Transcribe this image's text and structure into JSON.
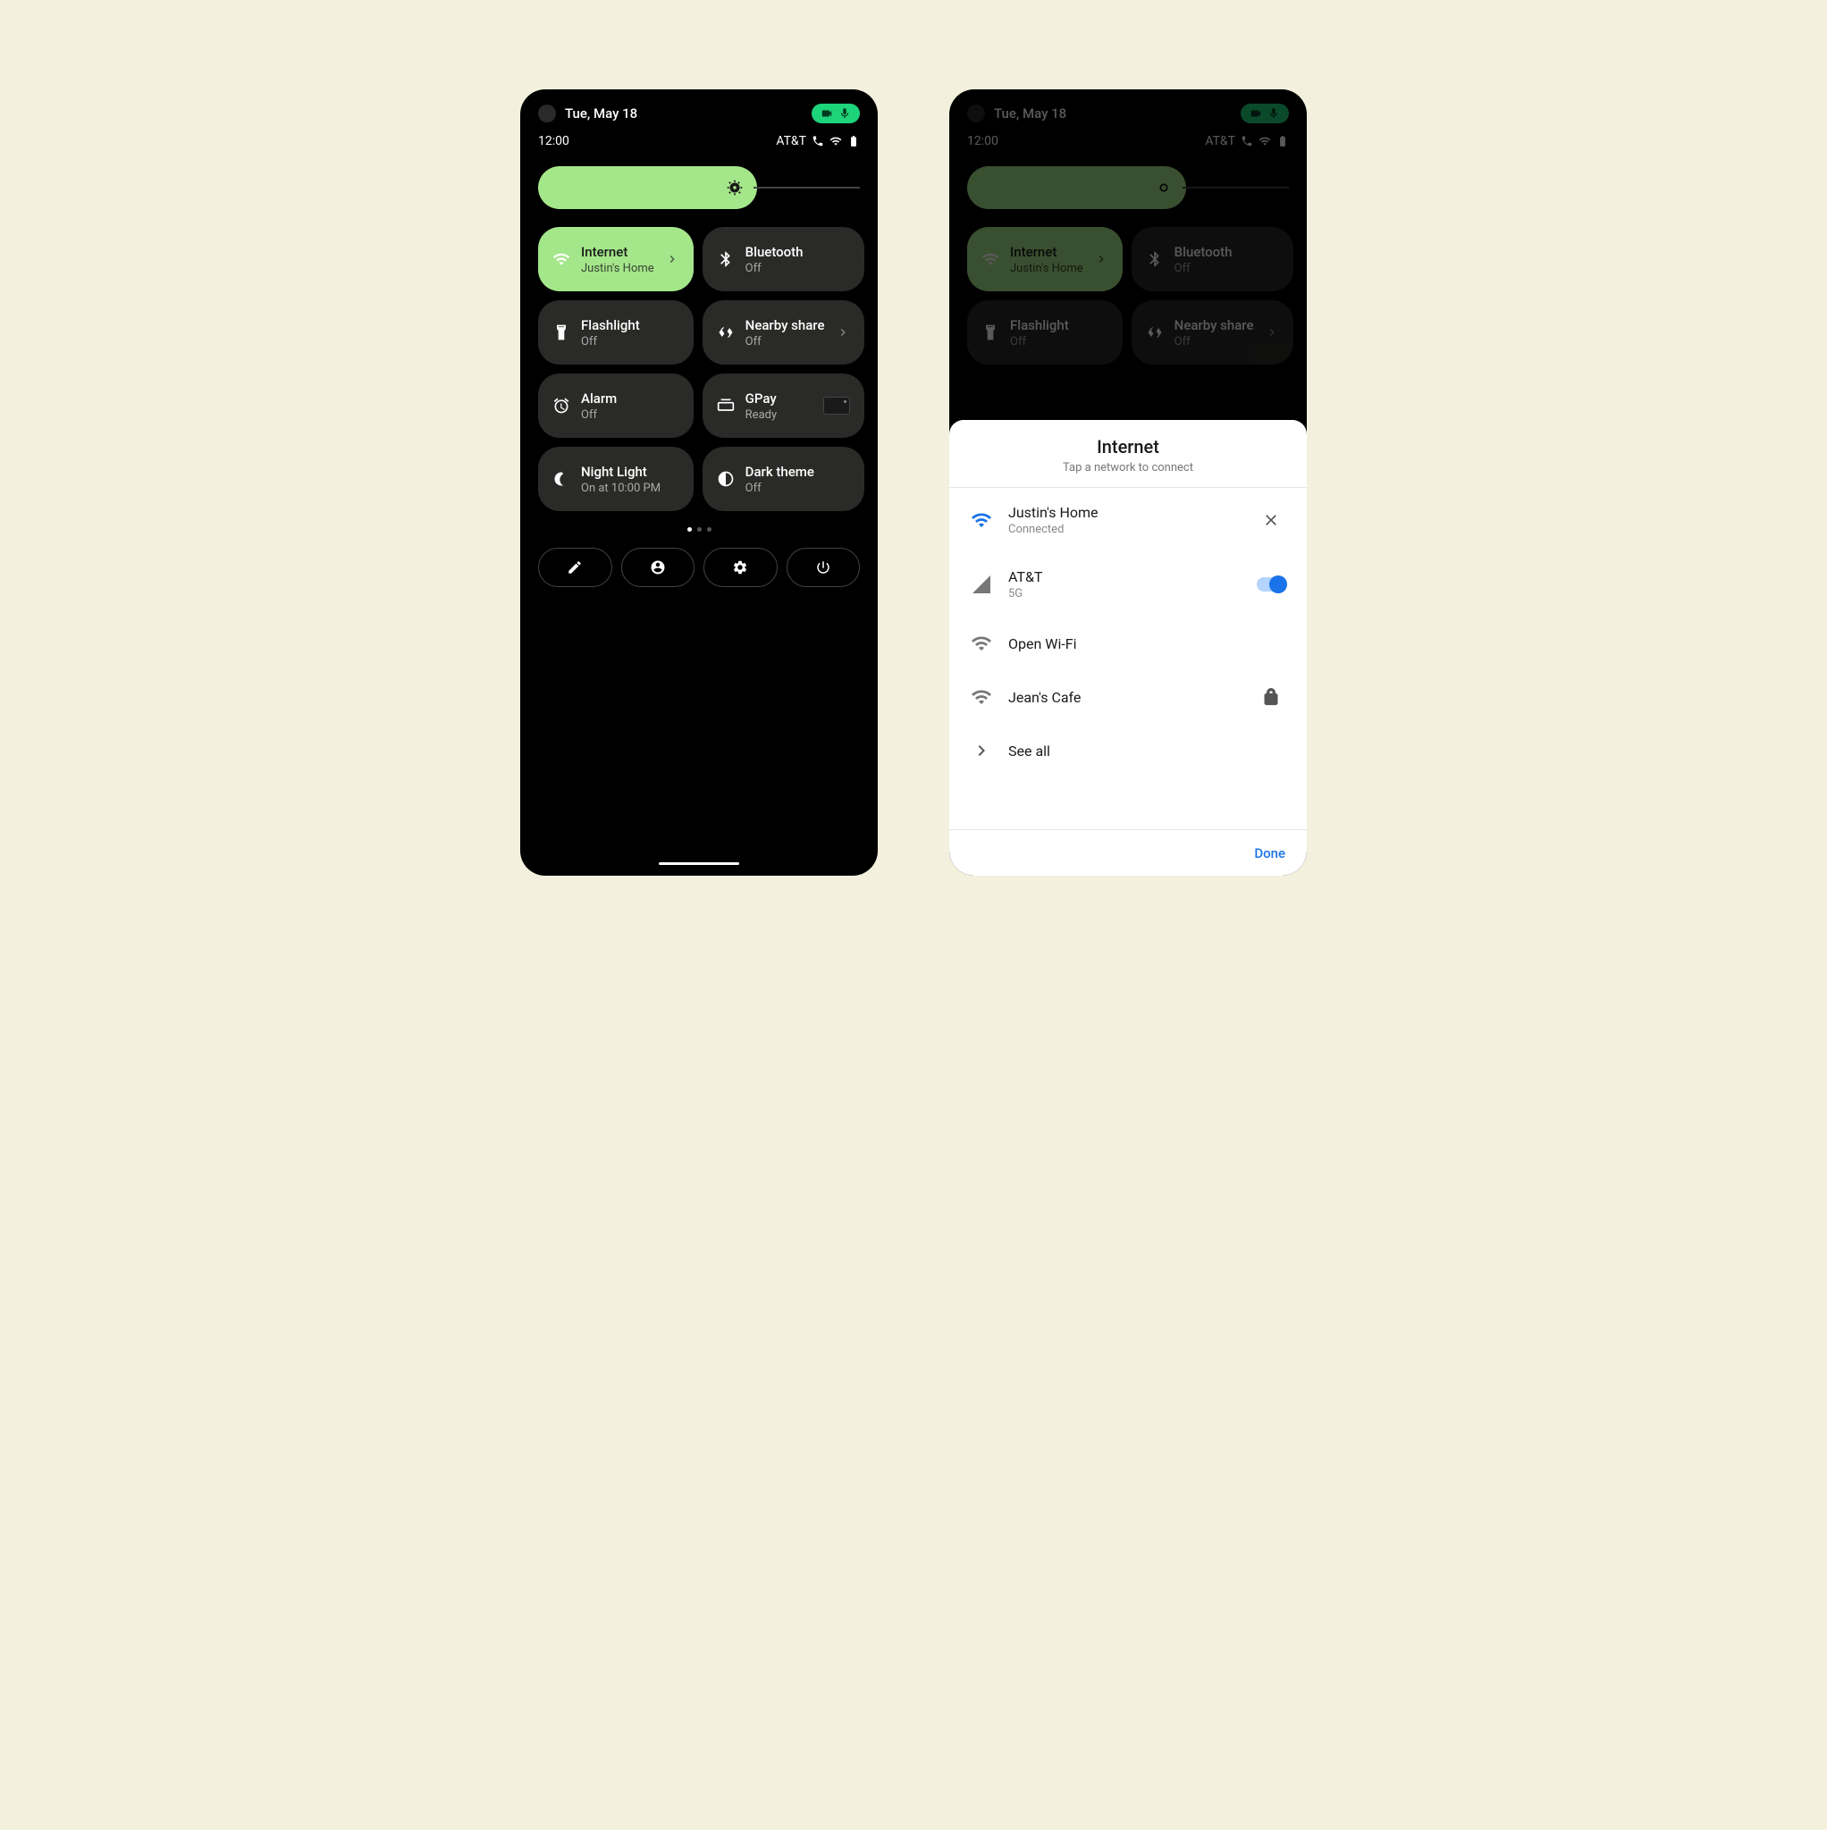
{
  "status": {
    "date": "Tue, May 18",
    "time": "12:00",
    "carrier": "AT&T"
  },
  "tiles": [
    {
      "title": "Internet",
      "sub": "Justin's Home",
      "icon": "wifi",
      "active": true,
      "chevron": true
    },
    {
      "title": "Bluetooth",
      "sub": "Off",
      "icon": "bluetooth",
      "active": false,
      "chevron": false
    },
    {
      "title": "Flashlight",
      "sub": "Off",
      "icon": "flashlight",
      "active": false,
      "chevron": false
    },
    {
      "title": "Nearby share",
      "sub": "Off",
      "icon": "nearby",
      "active": false,
      "chevron": true
    },
    {
      "title": "Alarm",
      "sub": "Off",
      "icon": "alarm",
      "active": false,
      "chevron": false
    },
    {
      "title": "GPay",
      "sub": "Ready",
      "icon": "wallet",
      "active": false,
      "card": true
    },
    {
      "title": "Night Light",
      "sub": "On at 10:00 PM",
      "icon": "moon",
      "active": false,
      "chevron": false
    },
    {
      "title": "Dark theme",
      "sub": "Off",
      "icon": "contrast",
      "active": false,
      "chevron": false
    }
  ],
  "sheet": {
    "title": "Internet",
    "subtitle": "Tap a network to connect",
    "networks": [
      {
        "name": "Justin's Home",
        "sub": "Connected",
        "icon": "wifi-blue",
        "action": "close"
      },
      {
        "name": "AT&T",
        "sub": "5G",
        "icon": "cellular",
        "action": "toggle"
      },
      {
        "name": "Open Wi-Fi",
        "sub": "",
        "icon": "wifi-grey",
        "action": ""
      },
      {
        "name": "Jean's Cafe",
        "sub": "",
        "icon": "wifi-grey",
        "action": "lock"
      },
      {
        "name": "See all",
        "sub": "",
        "icon": "chevron",
        "action": ""
      }
    ],
    "done": "Done"
  }
}
